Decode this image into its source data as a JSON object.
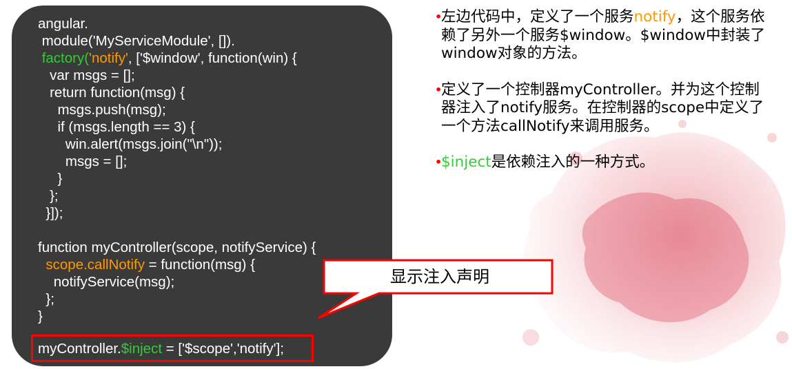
{
  "code": {
    "lines": [
      [
        {
          "t": "angular."
        }
      ],
      [
        {
          "t": " module('MyServiceModule', [])."
        }
      ],
      [
        {
          "t": " "
        },
        {
          "t": "factory(",
          "c": "green"
        },
        {
          "t": "'notify'",
          "c": "orange"
        },
        {
          "t": ", ['$window', function(win) {"
        }
      ],
      [
        {
          "t": "   var msgs = [];"
        }
      ],
      [
        {
          "t": "   return function(msg) {"
        }
      ],
      [
        {
          "t": "     msgs.push(msg);"
        }
      ],
      [
        {
          "t": "     if (msgs.length == 3) {"
        }
      ],
      [
        {
          "t": "       win.alert(msgs.join(\"\\n\"));"
        }
      ],
      [
        {
          "t": "       msgs = [];"
        }
      ],
      [
        {
          "t": "     }"
        }
      ],
      [
        {
          "t": "   };"
        }
      ],
      [
        {
          "t": "  }]);"
        }
      ],
      [
        {
          "t": ""
        }
      ],
      [
        {
          "t": "function myController(scope, notifyService) {"
        }
      ],
      [
        {
          "t": "  "
        },
        {
          "t": "scope.callNotify",
          "c": "orange"
        },
        {
          "t": " = function(msg) {"
        }
      ],
      [
        {
          "t": "    notifyService(msg);"
        }
      ],
      [
        {
          "t": "  };"
        }
      ],
      [
        {
          "t": "}"
        }
      ]
    ],
    "inject_line": [
      {
        "t": "myController."
      },
      {
        "t": "$inject",
        "c": "green"
      },
      {
        "t": " = ['$scope','notify'];"
      }
    ]
  },
  "callout": {
    "text": "显示注入声明"
  },
  "notes": [
    [
      {
        "t": "左边代码中，定义了一个服务"
      },
      {
        "t": "notify",
        "c": "orange"
      },
      {
        "t": "，这个服务依赖了另外一个服务$window。$window中封装了window对象的方法。"
      }
    ],
    [
      {
        "t": "定义了一个控制器myController。并为这个控制器注入了notify服务。在控制器的scope中定义了一个方法callNotify来调用服务。"
      }
    ],
    [
      {
        "t": "$inject",
        "c": "green"
      },
      {
        "t": "是依赖注入的一种方式。"
      }
    ]
  ],
  "colors": {
    "green": "#33cc33",
    "orange": "#ff9900",
    "red": "#ff0000",
    "panel": "#3a3a3a"
  }
}
